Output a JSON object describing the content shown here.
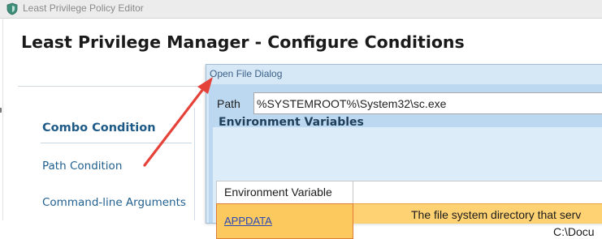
{
  "window": {
    "title": "Least Privilege Policy Editor",
    "icon": "shield-icon"
  },
  "page": {
    "title": "Least Privilege Manager - Configure Conditions"
  },
  "sidebar": {
    "items": [
      {
        "label": "Combo Condition",
        "selected": true
      },
      {
        "label": "Path Condition",
        "selected": false
      },
      {
        "label": "Command-line Arguments",
        "selected": false
      }
    ]
  },
  "dialog": {
    "title": "Open File Dialog",
    "path_label": "Path",
    "path_value": "%SYSTEMROOT%\\System32\\sc.exe",
    "section_heading": "Environment Variables",
    "grid": {
      "columns": [
        "Environment Variable"
      ],
      "rows": [
        {
          "variable": "APPDATA",
          "description": "The file system directory that serv",
          "description_line2": "C:\\Docu"
        }
      ]
    }
  },
  "annotation": {
    "type": "arrow",
    "color": "#e5433a"
  },
  "colors": {
    "accent_link": "#1f5f8f",
    "selected_row": "#fed173",
    "dialog_bg": "#bcd8f0"
  }
}
